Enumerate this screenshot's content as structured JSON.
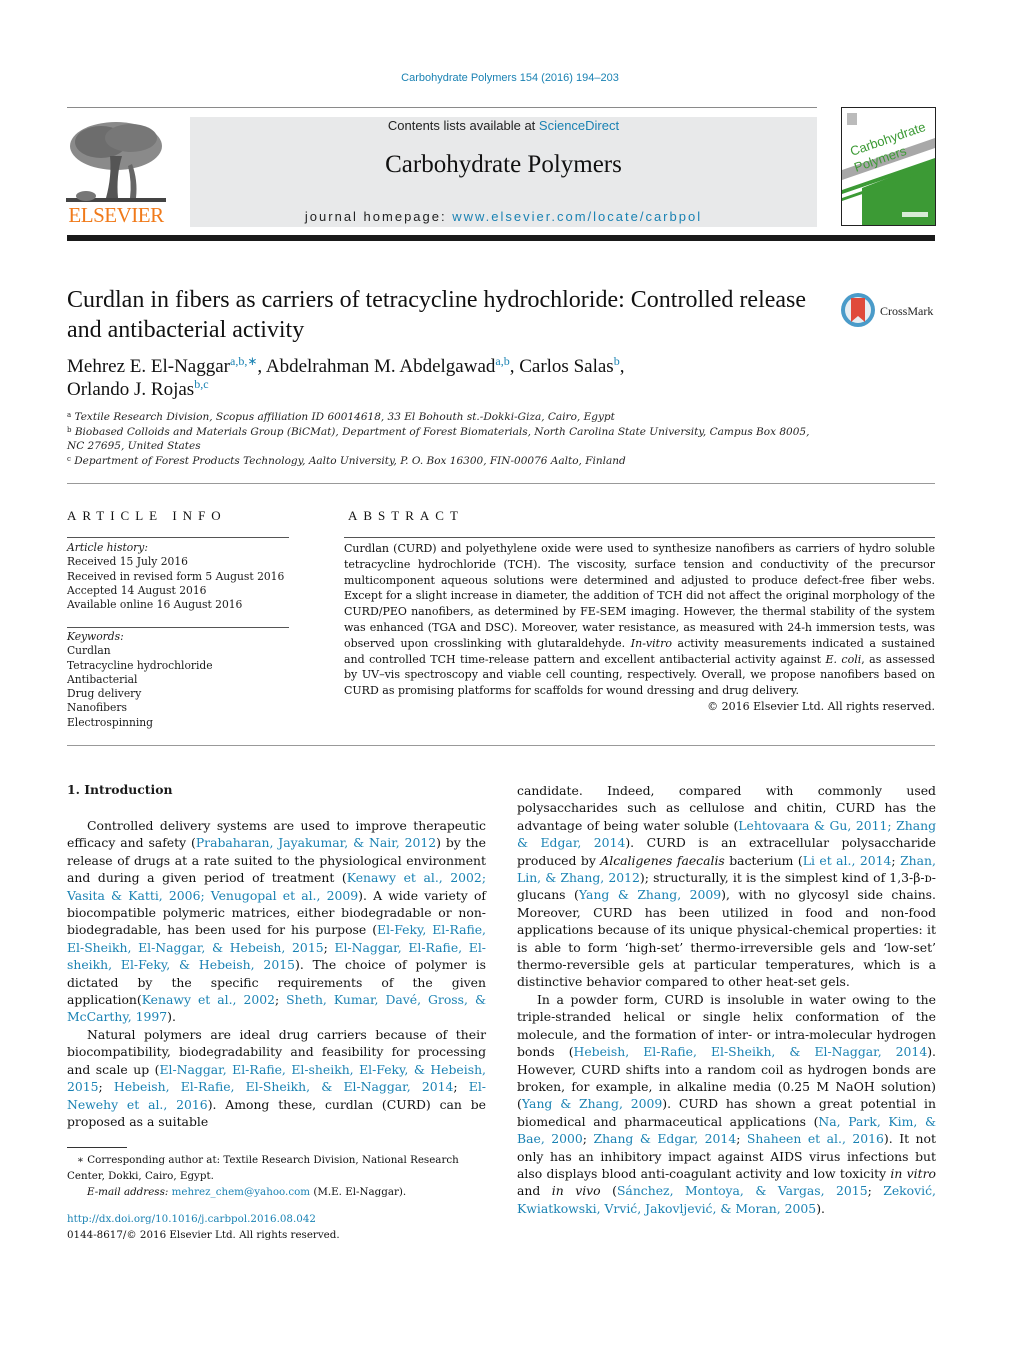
{
  "header": {
    "citation": "Carbohydrate Polymers 154 (2016) 194–203",
    "contents_prefix": "Contents lists available at ",
    "contents_link": "ScienceDirect",
    "journal_name": "Carbohydrate Polymers",
    "homepage_prefix": "journal homepage: ",
    "homepage_link": "www.elsevier.com/locate/carbpol",
    "publisher_logo_text": "ELSEVIER",
    "cover_title_line1": "Carbohydrate",
    "cover_title_line2": "Polymers",
    "colors": {
      "link": "#1a82b3",
      "elsevier_orange": "#f07a1a",
      "cover_green": "#3c9a35",
      "header_gray": "#e8e9ea"
    }
  },
  "article": {
    "title": "Curdlan in fibers as carriers of tetracycline hydrochloride: Controlled release and antibacterial activity",
    "crossmark_label": "CrossMark",
    "authors": [
      {
        "name": "Mehrez E. El-Naggar",
        "aff": "a,b,∗",
        "sep": ", "
      },
      {
        "name": "Abdelrahman M. Abdelgawad",
        "aff": "a,b",
        "sep": ", "
      },
      {
        "name": "Carlos Salas",
        "aff": "b",
        "sep": ","
      },
      {
        "name": "Orlando J. Rojas",
        "aff": "b,c",
        "sep": ""
      }
    ],
    "affiliations": [
      {
        "key": "a",
        "text": "Textile Research Division, Scopus affiliation ID 60014618, 33 El Bohouth st.-Dokki-Giza, Cairo, Egypt"
      },
      {
        "key": "b",
        "text": "Biobased Colloids and Materials Group (BiCMat), Department of Forest Biomaterials, North Carolina State University, Campus Box 8005, NC 27695, United States"
      },
      {
        "key": "c",
        "text": "Department of Forest Products Technology, Aalto University, P. O. Box 16300, FIN-00076 Aalto, Finland"
      }
    ]
  },
  "article_info": {
    "heading": "ARTICLE INFO",
    "history_label": "Article history:",
    "history": [
      "Received 15 July 2016",
      "Received in revised form 5 August 2016",
      "Accepted 14 August 2016",
      "Available online 16 August 2016"
    ],
    "keywords_label": "Keywords:",
    "keywords": [
      "Curdlan",
      "Tetracycline hydrochloride",
      "Antibacterial",
      "Drug delivery",
      "Nanofibers",
      "Electrospinning"
    ]
  },
  "abstract": {
    "heading": "ABSTRACT",
    "p1": "Curdlan (CURD) and polyethylene oxide were used to synthesize nanofibers as carriers of hydro soluble tetracycline hydrochloride (TCH). The viscosity, surface tension and conductivity of the precursor multicomponent aqueous solutions were determined and adjusted to produce defect-free fiber webs. Except for a slight increase in diameter, the addition of TCH did not affect the original morphology of the CURD/PEO nanofibers, as determined by FE-SEM imaging. However, the thermal stability of the system was enhanced (TGA and DSC). Moreover, water resistance, as measured with 24-h immersion tests, was observed upon crosslinking with glutaraldehyde. ",
    "p1_italic": "In-vitro",
    "p2": " activity measurements indicated a sustained and controlled TCH time-release pattern and excellent antibacterial activity against ",
    "p2_italic": "E. coli",
    "p3": ", as assessed by UV–vis spectroscopy and viable cell counting, respectively. Overall, we propose nanofibers based on CURD as promising platforms for scaffolds for wound dressing and drug delivery.",
    "copyright": "© 2016 Elsevier Ltd. All rights reserved."
  },
  "body": {
    "section_heading": "1.  Introduction",
    "left": {
      "para1": [
        {
          "t": "Controlled delivery systems are used to improve therapeutic efficacy and safety ("
        },
        {
          "l": "Prabaharan, Jayakumar, & Nair, 2012"
        },
        {
          "t": ") by the release of drugs at a rate suited to the physiological environment and during a given period of treatment ("
        },
        {
          "l": "Kenawy et al., 2002; Vasita & Katti, 2006; Venugopal et al., 2009"
        },
        {
          "t": "). A wide variety of biocompatible polymeric matrices, either biodegradable or non-biodegradable, has been used for his purpose ("
        },
        {
          "l": "El-Feky, El-Rafie, El-Sheikh, El-Naggar, & Hebeish, 2015"
        },
        {
          "t": "; "
        },
        {
          "l": "El-Naggar, El-Rafie, El-sheikh, El-Feky, & Hebeish, 2015"
        },
        {
          "t": "). The choice of polymer is dictated by the specific requirements of the given application("
        },
        {
          "l": "Kenawy et al., 2002"
        },
        {
          "t": "; "
        },
        {
          "l": "Sheth, Kumar, Davé, Gross, & McCarthy, 1997"
        },
        {
          "t": ")."
        }
      ],
      "para2": [
        {
          "t": "Natural polymers are ideal drug carriers because of their biocompatibility, biodegradability and feasibility for processing and scale up ("
        },
        {
          "l": "El-Naggar, El-Rafie, El-sheikh, El-Feky, & Hebeish, 2015"
        },
        {
          "t": "; "
        },
        {
          "l": "Hebeish, El-Rafie, El-Sheikh, & El-Naggar, 2014"
        },
        {
          "t": "; "
        },
        {
          "l": "El-Newehy et al., 2016"
        },
        {
          "t": "). Among these, curdlan (CURD) can be proposed as a suitable"
        }
      ]
    },
    "right": {
      "para1": [
        {
          "t": "candidate. Indeed, compared with commonly used polysaccharides such as cellulose and chitin, CURD has the advantage of being water soluble ("
        },
        {
          "l": "Lehtovaara & Gu, 2011; Zhang & Edgar, 2014"
        },
        {
          "t": "). CURD is an extracellular polysaccharide produced by "
        },
        {
          "i": "Alcaligenes faecalis"
        },
        {
          "t": " bacterium ("
        },
        {
          "l": "Li et al., 2014"
        },
        {
          "t": "; "
        },
        {
          "l": "Zhan, Lin, & Zhang, 2012"
        },
        {
          "t": "); structurally, it is the simplest kind of 1,3-β-ᴅ-glucans ("
        },
        {
          "l": "Yang & Zhang, 2009"
        },
        {
          "t": "), with no glycosyl side chains. Moreover, CURD has been utilized in food and non-food applications because of its unique physical-chemical properties: it is able to form ‘high-set’ thermo-irreversible gels and ‘low-set’ thermo-reversible gels at particular temperatures, which is a distinctive behavior compared to other heat-set gels."
        }
      ],
      "para2": [
        {
          "t": "In a powder form, CURD is insoluble in water owing to the triple-stranded helical or single helix conformation of the molecule, and the formation of inter- or intra-molecular hydrogen bonds ("
        },
        {
          "l": "Hebeish, El-Rafie, El-Sheikh, & El-Naggar, 2014"
        },
        {
          "t": "). However, CURD shifts into a random coil as hydrogen bonds are broken, for example, in alkaline media (0.25 M NaOH solution) ("
        },
        {
          "l": "Yang & Zhang, 2009"
        },
        {
          "t": "). CURD has shown a great potential in biomedical and pharmaceutical applications ("
        },
        {
          "l": "Na, Park, Kim, & Bae, 2000"
        },
        {
          "t": "; "
        },
        {
          "l": "Zhang & Edgar, 2014"
        },
        {
          "t": "; "
        },
        {
          "l": "Shaheen et al., 2016"
        },
        {
          "t": "). It not only has an inhibitory impact against AIDS virus infections but also displays blood anti-coagulant activity and low toxicity "
        },
        {
          "i": "in vitro"
        },
        {
          "t": " and "
        },
        {
          "i": "in vivo"
        },
        {
          "t": " ("
        },
        {
          "l": "Sánchez, Montoya, & Vargas, 2015"
        },
        {
          "t": "; "
        },
        {
          "l": "Zeković, Kwiatkowski, Vrvić, Jakovljević, & Moran, 2005"
        },
        {
          "t": ")."
        }
      ]
    }
  },
  "footnotes": {
    "corresponding": "∗  Corresponding author at: Textile Research Division, National Research Center, Dokki, Cairo, Egypt.",
    "email_label": "E-mail address: ",
    "email": "mehrez_chem@yahoo.com",
    "email_suffix": " (M.E. El-Naggar).",
    "doi": "http://dx.doi.org/10.1016/j.carbpol.2016.08.042",
    "issn_copyright": "0144-8617/© 2016 Elsevier Ltd. All rights reserved."
  }
}
